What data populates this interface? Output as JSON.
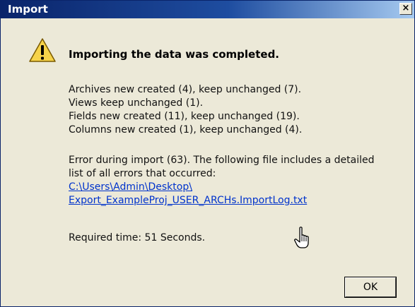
{
  "window": {
    "title": "Import",
    "close_label": "×"
  },
  "message": {
    "heading": "Importing the data was completed.",
    "summary": [
      "Archives new created (4), keep unchanged (7).",
      "Views keep unchanged (1).",
      "Fields new created (11), keep unchanged (19).",
      "Columns new created (1), keep unchanged (4)."
    ],
    "error_lines": [
      "Error during import (63). The following file includes a detailed",
      "list of all errors that occurred:"
    ],
    "log_link_lines": [
      "C:\\Users\\Admin\\Desktop\\",
      "Export_ExampleProj_USER_ARCHs.ImportLog.txt"
    ],
    "required_time": "Required time: 51 Seconds."
  },
  "buttons": {
    "ok_label": "OK"
  },
  "icons": {
    "warning": "warning-icon",
    "cursor": "hand-pointer-icon"
  },
  "colors": {
    "titlebar": "#0a246a",
    "background": "#ece9d8",
    "link": "#0033cc"
  }
}
